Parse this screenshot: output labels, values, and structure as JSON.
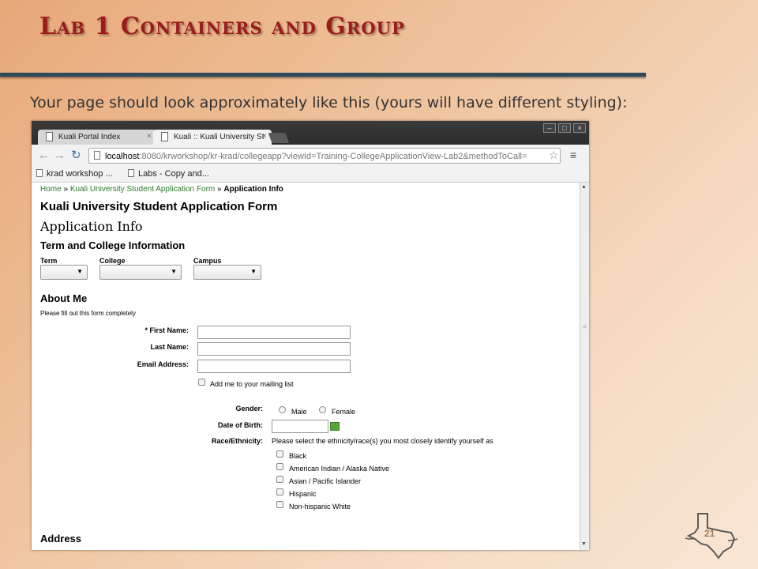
{
  "slide": {
    "title": "Lab 1 Containers and Group",
    "subtitle": "Your page should look approximately like this (yours will have different styling):",
    "page_number": "21"
  },
  "browser": {
    "tabs": [
      {
        "label": "Kuali Portal Index",
        "close": "×"
      },
      {
        "label": "Kuali :: Kuali University St",
        "close": "×"
      }
    ],
    "window_buttons": {
      "minimize": "–",
      "maximize": "□",
      "close": "×"
    },
    "nav": {
      "back": "←",
      "forward": "→",
      "reload": "↻"
    },
    "url": {
      "host": "localhost",
      "rest": ":8080/krworkshop/kr-krad/collegeapp?viewId=Training-CollegeApplicationView-Lab2&methodToCall="
    },
    "star": "☆",
    "menu": "≡",
    "bookmarks": [
      "krad workshop ...",
      "Labs - Copy and..."
    ]
  },
  "form": {
    "breadcrumb": {
      "home": "Home",
      "sep1": " » ",
      "app": "Kuali University Student Application Form",
      "sep2": " » ",
      "current": "Application Info"
    },
    "title": "Kuali University Student Application Form",
    "page_title": "Application Info",
    "term_section": {
      "heading": "Term and College Information",
      "fields": [
        {
          "label": "Term",
          "value": ""
        },
        {
          "label": "College",
          "value": ""
        },
        {
          "label": "Campus",
          "value": ""
        }
      ]
    },
    "about_me": {
      "heading": "About Me",
      "instructions": "Please fill out this form completely",
      "first_name_label": "* First Name:",
      "last_name_label": "Last Name:",
      "email_label": "Email Address:",
      "mailing_list_label": "Add me to your mailing list",
      "gender_label": "Gender:",
      "gender_options": [
        "Male",
        "Female"
      ],
      "dob_label": "Date of Birth:",
      "race_label": "Race/Ethnicity:",
      "race_instructions": "Please select the ethnicity/race(s) you most closely identify yourself as",
      "race_options": [
        "Black",
        "American Indian / Alaska Native",
        "Asian / Pacific Islander",
        "Hispanic",
        "Non-hispanic White"
      ]
    },
    "address_heading": "Address"
  },
  "caret": "▼",
  "scroll": {
    "up": "▲",
    "down": "▼",
    "grip": "≡"
  }
}
